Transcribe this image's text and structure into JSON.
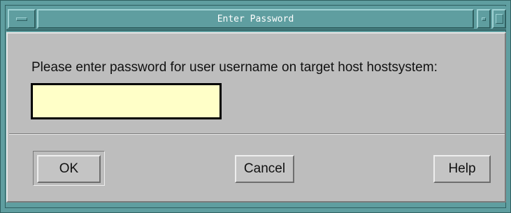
{
  "window": {
    "title": "Enter Password"
  },
  "dialog": {
    "prompt": "Please enter password for user username on target host hostsystem:",
    "password_value": ""
  },
  "buttons": {
    "ok_label": "OK",
    "cancel_label": "Cancel",
    "help_label": "Help"
  },
  "icons": {
    "window_menu": "window-menu-icon",
    "minimize": "minimize-icon",
    "maximize": "maximize-icon"
  },
  "colors": {
    "titlebar": "#5f9ea0",
    "client_background": "#bdbdbd",
    "input_background": "#ffffc8"
  }
}
